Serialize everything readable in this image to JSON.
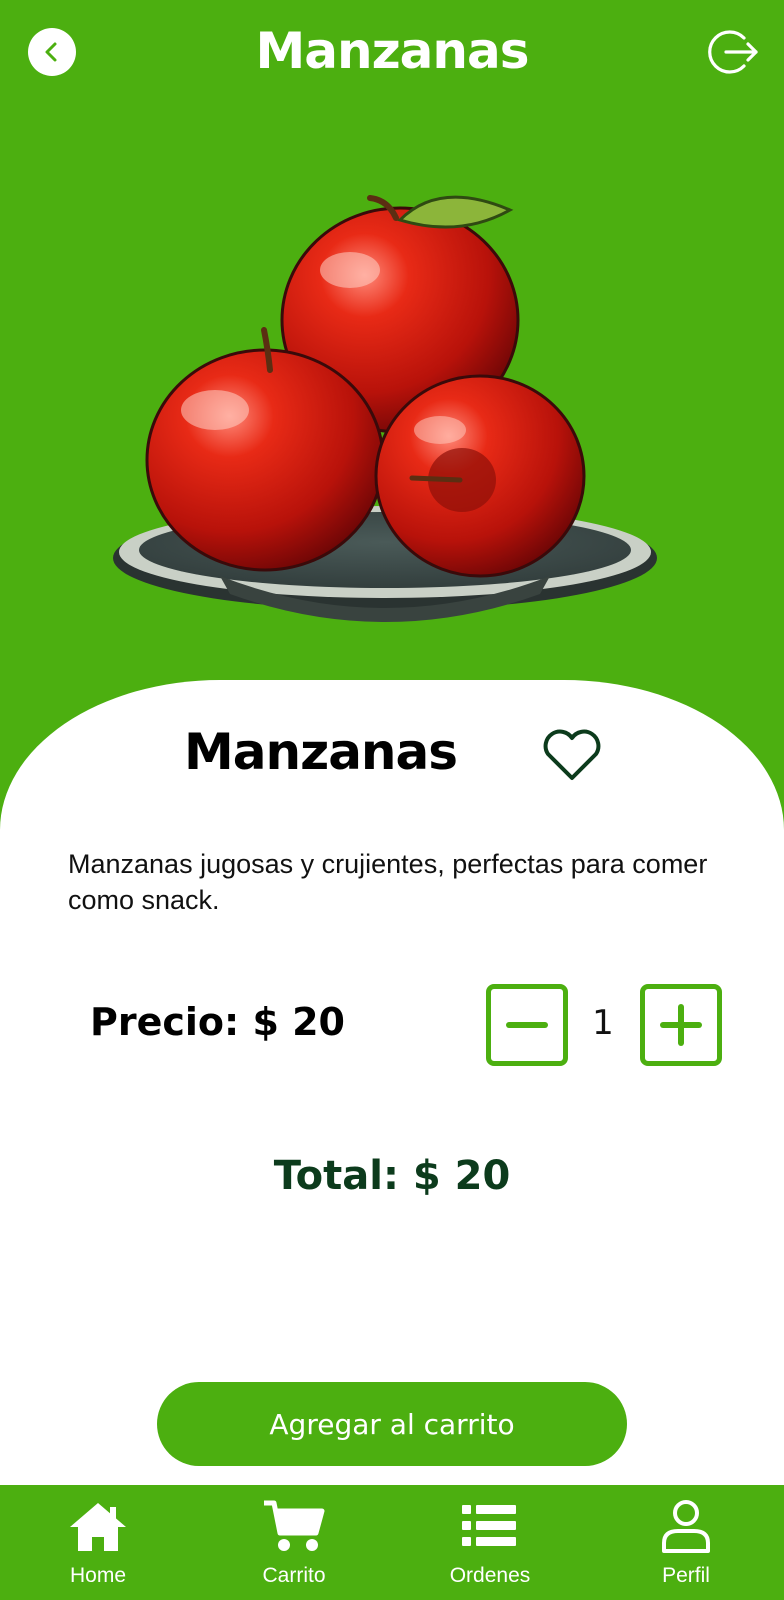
{
  "header": {
    "title": "Manzanas",
    "back_icon": "chevron-left-icon",
    "logout_icon": "logout-icon"
  },
  "product": {
    "name": "Manzanas",
    "description": "Manzanas jugosas y crujientes, perfectas para comer como snack.",
    "price_label": "Precio: $ 20",
    "quantity": "1",
    "total_label": "Total: $ 20",
    "favorite_icon": "heart-outline-icon"
  },
  "actions": {
    "add_to_cart": "Agregar al carrito"
  },
  "nav": {
    "items": [
      {
        "label": "Home",
        "icon": "home-icon"
      },
      {
        "label": "Carrito",
        "icon": "cart-icon"
      },
      {
        "label": "Ordenes",
        "icon": "list-icon"
      },
      {
        "label": "Perfil",
        "icon": "user-icon"
      }
    ]
  },
  "colors": {
    "brand_green": "#4caf10",
    "dark_green": "#0c3b1c",
    "white": "#ffffff"
  }
}
